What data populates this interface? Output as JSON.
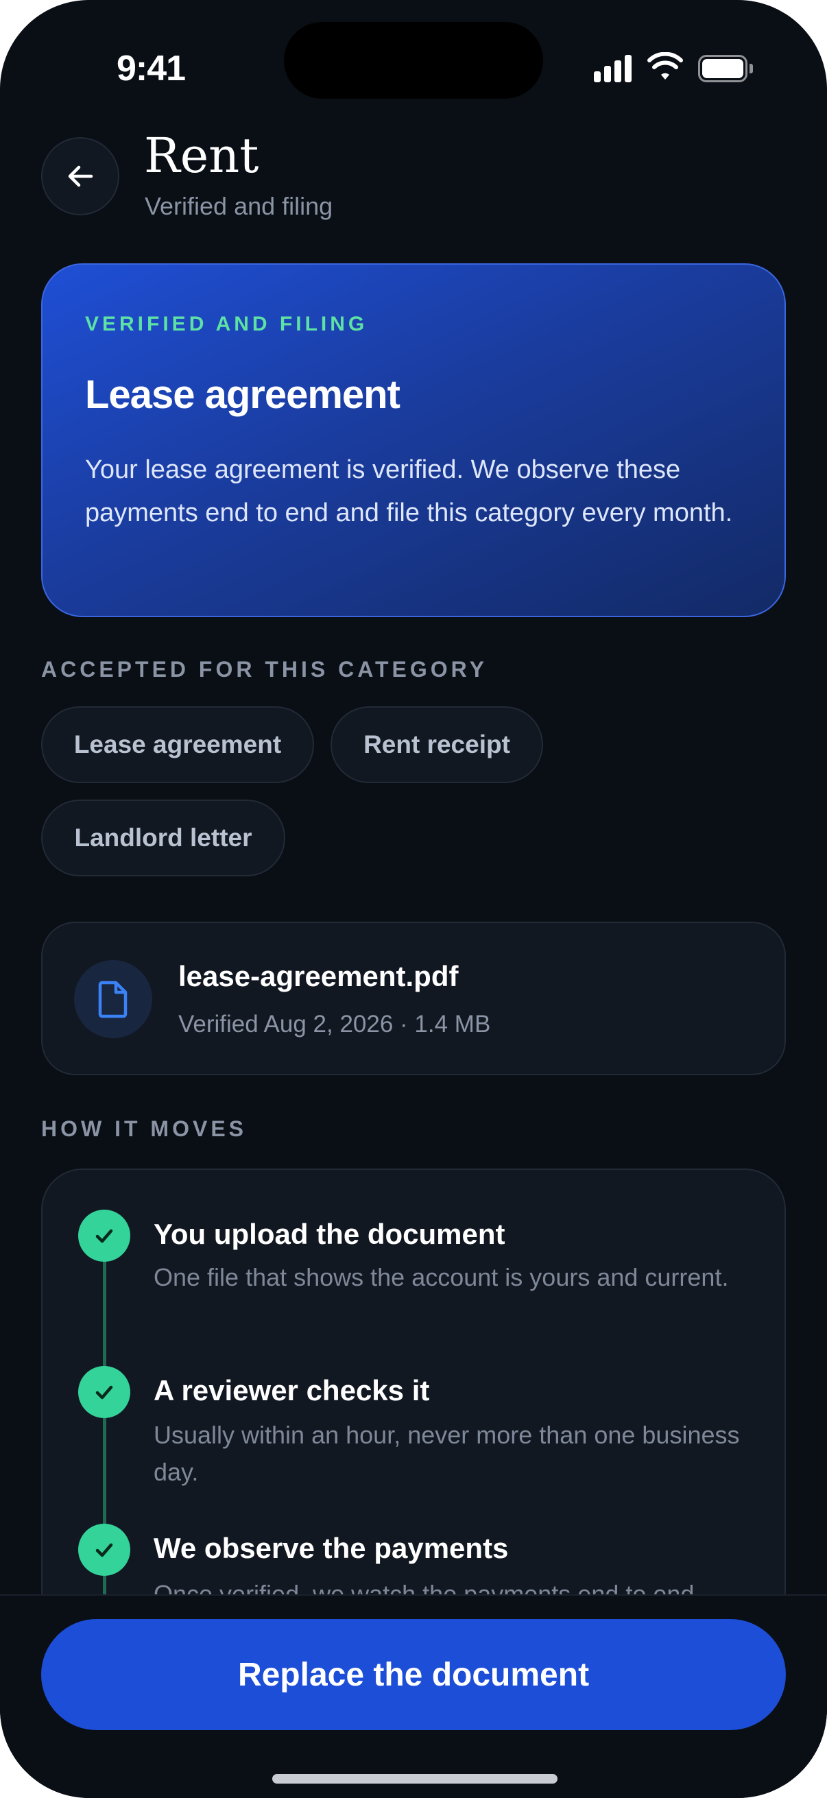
{
  "status_bar": {
    "time": "9:41"
  },
  "header": {
    "title": "Rent",
    "subtitle": "Verified and filing"
  },
  "hero": {
    "eyebrow": "VERIFIED AND FILING",
    "title": "Lease agreement",
    "body": "Your lease agreement is verified. We observe these payments end to end and file this category every month."
  },
  "accepted": {
    "label": "ACCEPTED FOR THIS CATEGORY",
    "chips": [
      "Lease agreement",
      "Rent receipt",
      "Landlord letter"
    ]
  },
  "file": {
    "name": "lease-agreement.pdf",
    "meta": "Verified Aug 2, 2026 · 1.4 MB",
    "icon": "document-icon"
  },
  "how_it_moves": {
    "label": "HOW IT MOVES",
    "steps": [
      {
        "title": "You upload the document",
        "desc": "One file that shows the account is yours and current."
      },
      {
        "title": "A reviewer checks it",
        "desc": "Usually within an hour, never more than one business day."
      },
      {
        "title": "We observe the payments",
        "desc": "Once verified, we watch the payments end to end."
      }
    ]
  },
  "actions": {
    "primary_label": "Replace the document"
  },
  "colors": {
    "background": "#0a0e15",
    "card": "#121822",
    "accent_blue": "#1d4ed8",
    "success_green": "#34d399",
    "eyebrow_green": "#5ee1a4"
  }
}
